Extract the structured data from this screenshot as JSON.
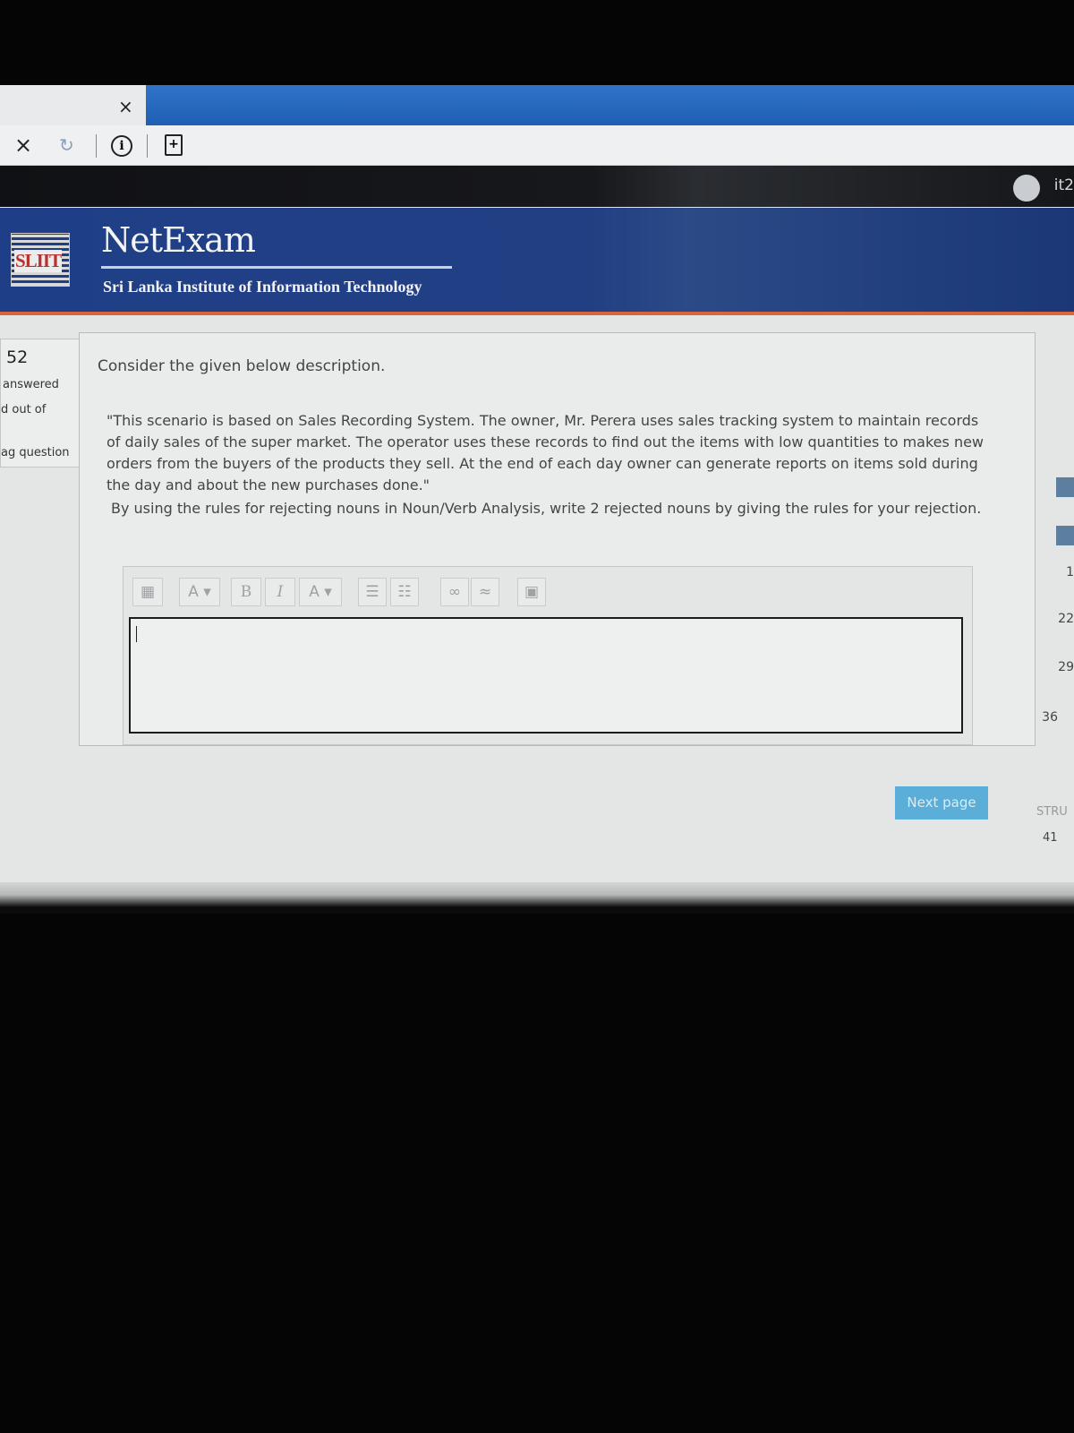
{
  "browser": {
    "tab_close": "×",
    "close_icon": "×",
    "reload_icon": "↻",
    "info_icon": "i",
    "doc_icon": "+",
    "user_name": "it2"
  },
  "header": {
    "brand": "NetExam",
    "logo_text": "SLIIT",
    "institute": "Sri Lanka Institute of Information Technology"
  },
  "quiz_nav": {
    "question": "52",
    "status": "answered",
    "marked": "d out of",
    "flag": "ag question"
  },
  "question": {
    "intro": "Consider the given below description.",
    "scenario": "\"This scenario is based on Sales Recording System.  The owner, Mr. Perera uses sales tracking system to maintain records of daily sales of the super market. The operator uses these records to find out the items with low quantities to makes new orders from the buyers of the products they sell. At the end of each day owner can generate reports on items sold during the day and about the new purchases done.\"",
    "instruction": "By using the rules for rejecting nouns in Noun/Verb Analysis, write 2 rejected nouns by giving the rules for your rejection."
  },
  "editor": {
    "toolbar": [
      "A",
      "B",
      "I",
      "A"
    ],
    "answer_value": ""
  },
  "buttons": {
    "next_page": "Next page"
  },
  "right_nav": {
    "numbers": [
      "1",
      "22",
      "29",
      "36",
      "41"
    ],
    "section": "STRU"
  },
  "colors": {
    "header": "#1e3f88",
    "accent": "#d8653b",
    "button": "#5aaed8"
  }
}
